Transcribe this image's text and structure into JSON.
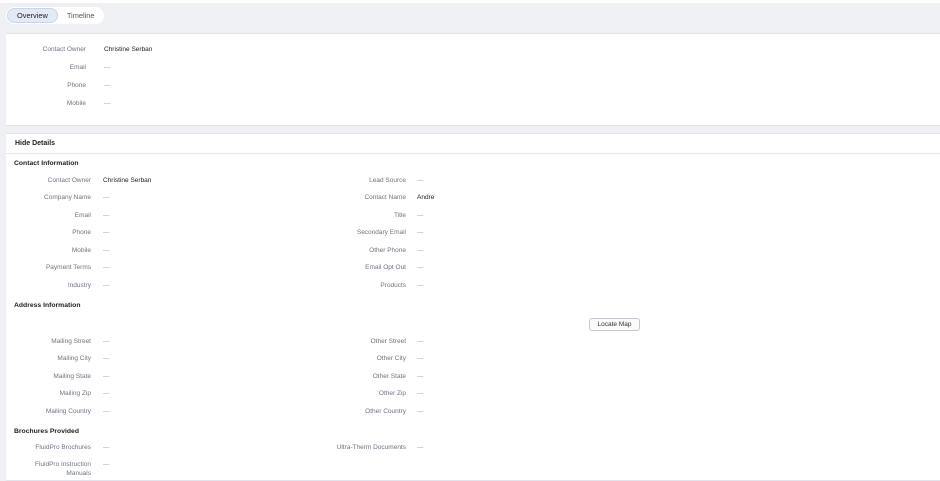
{
  "tabs": [
    {
      "label": "Overview"
    },
    {
      "label": "Timeline"
    }
  ],
  "overview": {
    "fields": [
      {
        "label": "Contact Owner",
        "value": "Christine Serban"
      },
      {
        "label": "Email",
        "value": "—"
      },
      {
        "label": "Phone",
        "value": "—"
      },
      {
        "label": "Mobile",
        "value": "—"
      }
    ]
  },
  "details": {
    "toggle_label": "Hide Details",
    "contact_section": "Contact Information",
    "contact_left": [
      {
        "label": "Contact Owner",
        "value": "Christine Serban"
      },
      {
        "label": "Company Name",
        "value": "—"
      },
      {
        "label": "Email",
        "value": "—"
      },
      {
        "label": "Phone",
        "value": "—"
      },
      {
        "label": "Mobile",
        "value": "—"
      },
      {
        "label": "Payment Terms",
        "value": "—"
      },
      {
        "label": "Industry",
        "value": "—"
      }
    ],
    "contact_right": [
      {
        "label": "Lead Source",
        "value": "—"
      },
      {
        "label": "Contact Name",
        "value": "Andre"
      },
      {
        "label": "Title",
        "value": "—"
      },
      {
        "label": "Secondary Email",
        "value": "—"
      },
      {
        "label": "Other Phone",
        "value": "—"
      },
      {
        "label": "Email Opt Out",
        "value": "—"
      },
      {
        "label": "Products",
        "value": "—"
      }
    ],
    "address_section": "Address Information",
    "locate_map_label": "Locate Map",
    "address_left": [
      {
        "label": "Mailing Street",
        "value": "—"
      },
      {
        "label": "Mailing City",
        "value": "—"
      },
      {
        "label": "Mailing State",
        "value": "—"
      },
      {
        "label": "Mailing Zip",
        "value": "—"
      },
      {
        "label": "Mailing Country",
        "value": "—"
      }
    ],
    "address_right": [
      {
        "label": "Other Street",
        "value": "—"
      },
      {
        "label": "Other City",
        "value": "—"
      },
      {
        "label": "Other State",
        "value": "—"
      },
      {
        "label": "Other Zip",
        "value": "—"
      },
      {
        "label": "Other Country",
        "value": "—"
      }
    ],
    "brochures_section": "Brochures Provided",
    "brochures_left": [
      {
        "label": "FluidPro Brochures",
        "value": "—"
      },
      {
        "label": "FluidPro Instruction Manuals",
        "value": "—"
      }
    ],
    "brochures_right": [
      {
        "label": "Ultra-Therm Documents",
        "value": "—"
      }
    ]
  }
}
